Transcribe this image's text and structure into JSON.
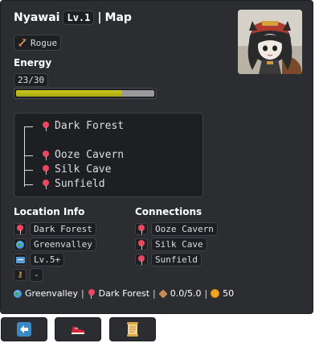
{
  "header": {
    "name": "Nyawai",
    "level": "Lv.1",
    "separator": "|",
    "section": "Map"
  },
  "character": {
    "class_icon": "dagger-icon",
    "class_label": "Rogue"
  },
  "energy": {
    "label": "Energy",
    "value": "23/30",
    "fraction": 0.7667,
    "fill_color": "#b8b61a"
  },
  "map": {
    "current": "Dark Forest",
    "children": [
      "Ooze Cavern",
      "Silk Cave",
      "Sunfield"
    ],
    "pin_icon": "round-pushpin-icon"
  },
  "location_info": {
    "title": "Location Info",
    "name": "Dark Forest",
    "region": "Greenvalley",
    "level_req": "Lv.5+",
    "key": "-"
  },
  "connections": {
    "title": "Connections",
    "items": [
      "Ooze Cavern",
      "Silk Cave",
      "Sunfield"
    ]
  },
  "footer": {
    "region": "Greenvalley",
    "location": "Dark Forest",
    "weight": "0.0/5.0",
    "gold": "50",
    "separator": "|"
  },
  "buttons": [
    {
      "name": "back",
      "icon": "left-arrow-icon"
    },
    {
      "name": "travel",
      "icon": "running-shoe-icon"
    },
    {
      "name": "quests",
      "icon": "scroll-icon"
    }
  ],
  "colors": {
    "panel_bg": "#2b2d31",
    "code_bg": "#1e1f22",
    "pin": "#e8475f",
    "back_button": "#3b88c3",
    "gold": "#f2a623"
  }
}
